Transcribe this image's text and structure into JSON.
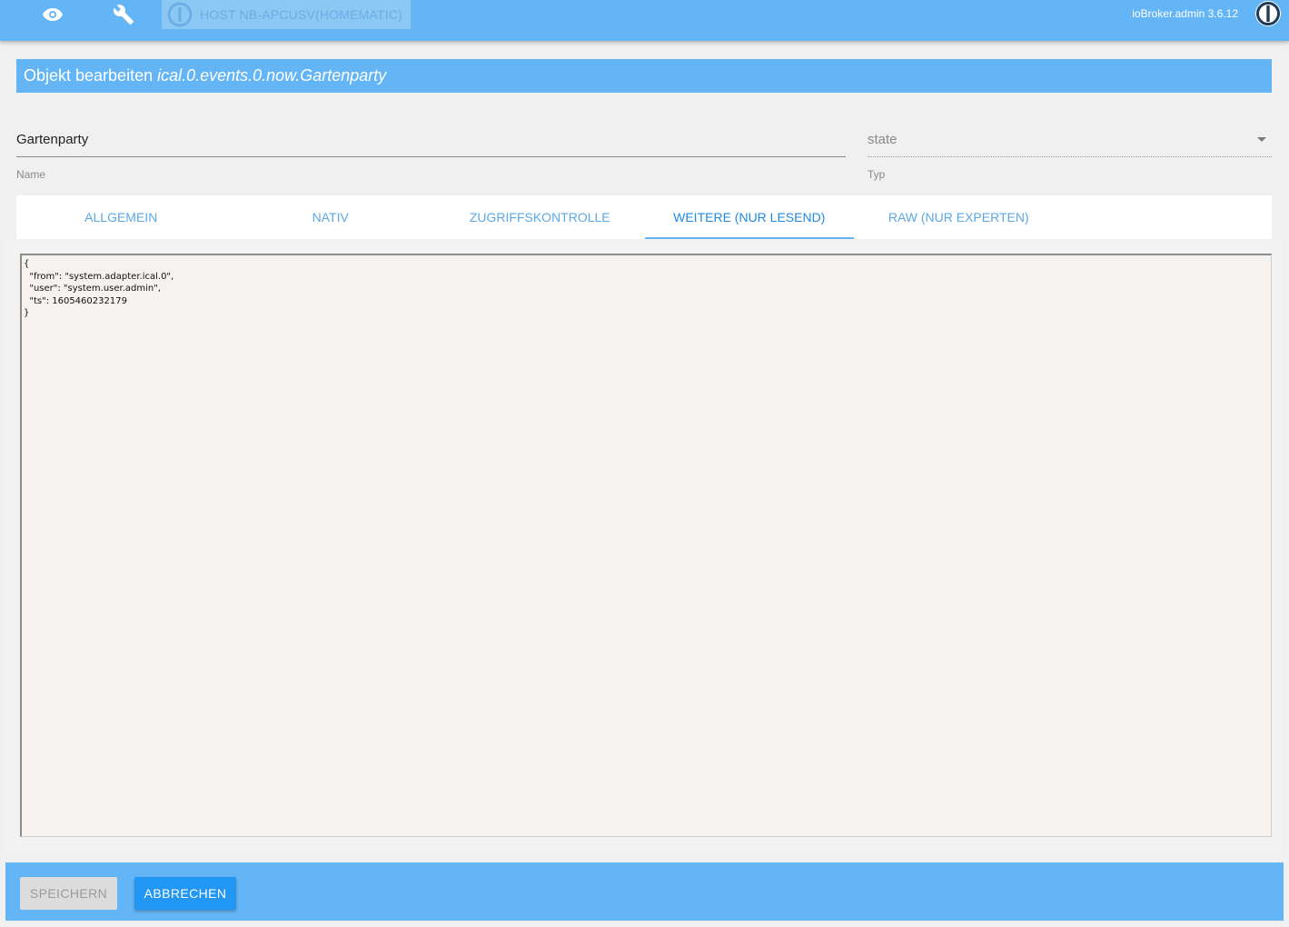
{
  "topbar": {
    "host_label": "HOST NB-APCUSV(HOMEMATIC)",
    "version": "ioBroker.admin 3.6.12",
    "icons": [
      "eye-icon",
      "wrench-icon",
      "iobroker-logo-icon"
    ]
  },
  "dialog": {
    "title_prefix": "Objekt bearbeiten",
    "object_id": "ical.0.events.0.now.Gartenparty"
  },
  "fields": {
    "name_value": "Gartenparty",
    "name_label": "Name",
    "type_value": "state",
    "type_label": "Typ"
  },
  "tabs": [
    {
      "label": "ALLGEMEIN",
      "active": false
    },
    {
      "label": "NATIV",
      "active": false
    },
    {
      "label": "ZUGRIFFSKONTROLLE",
      "active": false
    },
    {
      "label": "WEITERE (NUR LESEND)",
      "active": true
    },
    {
      "label": "RAW (NUR EXPERTEN)",
      "active": false
    }
  ],
  "json_text": "{\n  \"from\": \"system.adapter.ical.0\",\n  \"user\": \"system.user.admin\",\n  \"ts\": 1605460232179\n}",
  "footer": {
    "save_label": "SPEICHERN",
    "cancel_label": "ABBRECHEN"
  },
  "colors": {
    "primary": "#64b5f6",
    "accent": "#2196f3"
  }
}
